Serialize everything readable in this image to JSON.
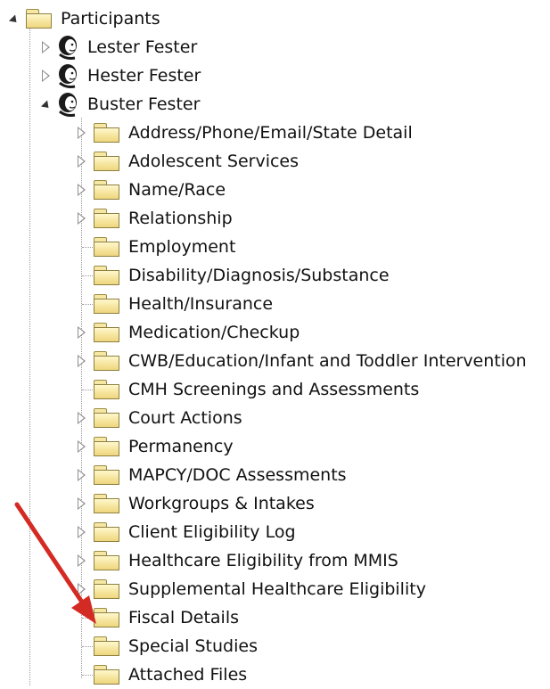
{
  "tree": {
    "root": {
      "label": "Participants",
      "icon": "folder-icon",
      "state": "expanded"
    },
    "people": [
      {
        "label": "Lester Fester",
        "icon": "person-icon",
        "state": "collapsed"
      },
      {
        "label": "Hester Fester",
        "icon": "person-icon",
        "state": "collapsed"
      },
      {
        "label": "Buster Fester",
        "icon": "person-icon",
        "state": "expanded"
      }
    ],
    "children": [
      {
        "label": "Address/Phone/Email/State Detail",
        "expandable": true
      },
      {
        "label": "Adolescent Services",
        "expandable": true
      },
      {
        "label": "Name/Race",
        "expandable": true
      },
      {
        "label": "Relationship",
        "expandable": true
      },
      {
        "label": "Employment",
        "expandable": false
      },
      {
        "label": "Disability/Diagnosis/Substance",
        "expandable": false
      },
      {
        "label": "Health/Insurance",
        "expandable": false
      },
      {
        "label": "Medication/Checkup",
        "expandable": true
      },
      {
        "label": "CWB/Education/Infant and Toddler Intervention",
        "expandable": true
      },
      {
        "label": "CMH Screenings and Assessments",
        "expandable": false
      },
      {
        "label": "Court Actions",
        "expandable": true
      },
      {
        "label": "Permanency",
        "expandable": true
      },
      {
        "label": "MAPCY/DOC Assessments",
        "expandable": true
      },
      {
        "label": "Workgroups & Intakes",
        "expandable": true
      },
      {
        "label": "Client Eligibility Log",
        "expandable": true
      },
      {
        "label": "Healthcare Eligibility from MMIS",
        "expandable": true
      },
      {
        "label": "Supplemental Healthcare Eligibility",
        "expandable": true
      },
      {
        "label": "Fiscal Details",
        "expandable": false
      },
      {
        "label": "Special Studies",
        "expandable": false
      },
      {
        "label": "Attached Files",
        "expandable": false
      }
    ]
  },
  "annotation": {
    "icon": "red-arrow-icon",
    "color": "#d42a24",
    "points_to": "Fiscal Details"
  },
  "colors": {
    "folder_fill": "#f6e39a",
    "folder_border": "#8f8040",
    "tree_line": "#9a9a9a",
    "text": "#111111"
  }
}
